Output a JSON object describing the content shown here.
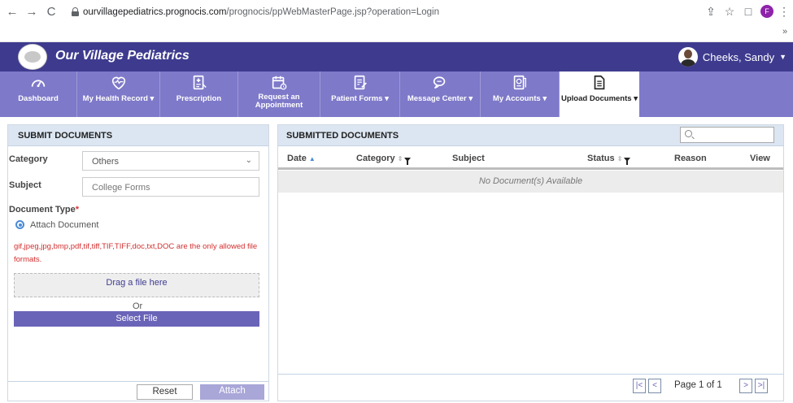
{
  "browser": {
    "url_domain": "ourvillagepediatrics.prognocis.com",
    "url_path": "/prognocis/ppWebMasterPage.jsp?operation=Login",
    "profile_initial": "F",
    "more": "»"
  },
  "header": {
    "app_title": "Our Village Pediatrics",
    "user_name": "Cheeks, Sandy"
  },
  "nav": {
    "items": [
      {
        "label": "Dashboard",
        "icon": "gauge-icon"
      },
      {
        "label": "My Health Record ▾",
        "icon": "heart-icon"
      },
      {
        "label": "Prescription",
        "icon": "prescription-icon"
      },
      {
        "label": "Request an Appointment",
        "icon": "calendar-icon"
      },
      {
        "label": "Patient Forms ▾",
        "icon": "form-icon"
      },
      {
        "label": "Message Center ▾",
        "icon": "chat-icon"
      },
      {
        "label": "My Accounts ▾",
        "icon": "accounts-icon"
      },
      {
        "label": "Upload Documents ▾",
        "icon": "upload-document-icon"
      }
    ],
    "active_index": 7,
    "appointment_line1": "Request an",
    "appointment_line2": "Appointment"
  },
  "submit": {
    "title": "SUBMIT DOCUMENTS",
    "category_label": "Category",
    "category_value": "Others",
    "subject_label": "Subject",
    "subject_placeholder": "College Forms",
    "doc_type_label": "Document Type",
    "required_mark": "*",
    "attach_option": "Attach Document",
    "formats_note": "gif,jpeg,jpg,bmp,pdf,tif,tiff,TIF,TIFF,doc,txt,DOC are the only allowed file formats.",
    "dropzone_text": "Drag a file here",
    "or_text": "Or",
    "select_file": "Select File",
    "reset": "Reset",
    "attach": "Attach"
  },
  "submitted": {
    "title": "SUBMITTED DOCUMENTS",
    "columns": {
      "date": "Date",
      "category": "Category",
      "subject": "Subject",
      "status": "Status",
      "reason": "Reason",
      "view": "View"
    },
    "empty_message": "No Document(s) Available",
    "page_label": "Page 1 of 1"
  }
}
